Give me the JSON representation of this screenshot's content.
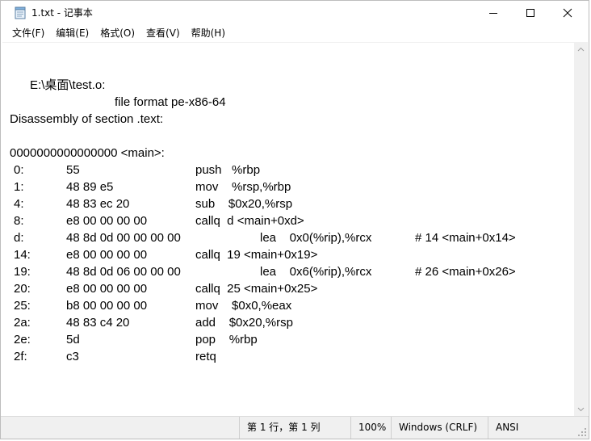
{
  "window": {
    "title": "1.txt - 记事本",
    "minimize_icon": "minimize-icon",
    "maximize_icon": "maximize-icon",
    "close_icon": "close-icon"
  },
  "menu": [
    "文件(F)",
    "编辑(E)",
    "格式(O)",
    "查看(V)",
    "帮助(H)"
  ],
  "content": {
    "header": "E:\\桌面\\test.o:",
    "file_format": "file format pe-x86-64",
    "section": "Disassembly of section .text:",
    "symbol": "0000000000000000 <main>:",
    "instructions": [
      {
        "addr": "0:",
        "bytes": "55",
        "asm": "push   %rbp",
        "comment": ""
      },
      {
        "addr": "1:",
        "bytes": "48 89 e5",
        "asm": "mov    %rsp,%rbp",
        "comment": ""
      },
      {
        "addr": "4:",
        "bytes": "48 83 ec 20",
        "asm": "sub    $0x20,%rsp",
        "comment": ""
      },
      {
        "addr": "8:",
        "bytes": "e8 00 00 00 00",
        "asm": "callq  d <main+0xd>",
        "comment": ""
      },
      {
        "addr": "d:",
        "bytes": "48 8d 0d 00 00 00 00",
        "asm": "lea    0x0(%rip),%rcx",
        "comment": "# 14 <main+0x14>"
      },
      {
        "addr": "14:",
        "bytes": "e8 00 00 00 00",
        "asm": "callq  19 <main+0x19>",
        "comment": ""
      },
      {
        "addr": "19:",
        "bytes": "48 8d 0d 06 00 00 00",
        "asm": "lea    0x6(%rip),%rcx",
        "comment": "# 26 <main+0x26>"
      },
      {
        "addr": "20:",
        "bytes": "e8 00 00 00 00",
        "asm": "callq  25 <main+0x25>",
        "comment": ""
      },
      {
        "addr": "25:",
        "bytes": "b8 00 00 00 00",
        "asm": "mov    $0x0,%eax",
        "comment": ""
      },
      {
        "addr": "2a:",
        "bytes": "48 83 c4 20",
        "asm": "add    $0x20,%rsp",
        "comment": ""
      },
      {
        "addr": "2e:",
        "bytes": "5d",
        "asm": "pop    %rbp",
        "comment": ""
      },
      {
        "addr": "2f:",
        "bytes": "c3",
        "asm": "retq",
        "comment": ""
      }
    ]
  },
  "status": {
    "position": "第 1 行，第 1 列",
    "zoom": "100%",
    "line_ending": "Windows (CRLF)",
    "encoding": "ANSI"
  }
}
